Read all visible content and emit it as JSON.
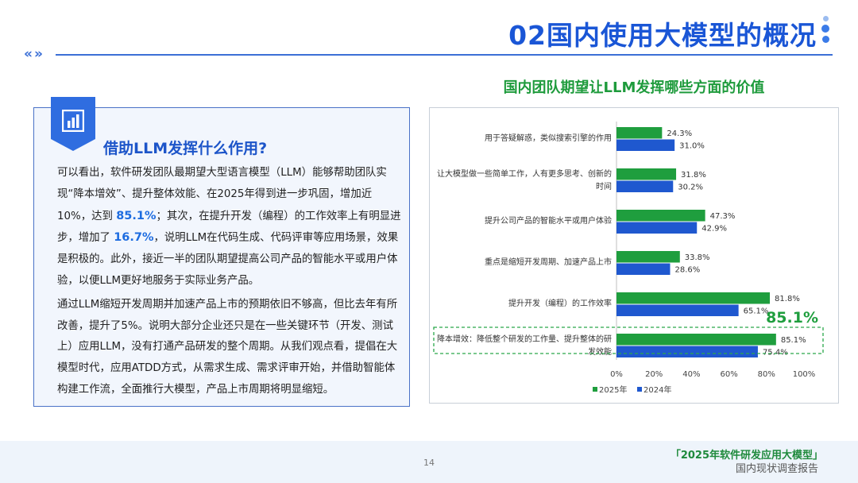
{
  "header": {
    "title": "02国内使用大模型的概况",
    "nav_symbol": "«»"
  },
  "left_panel": {
    "heading": "借助LLM发挥什么作用?",
    "para1_a": "可以看出，软件研发团队最期望大型语言模型（LLM）能够帮助团队实现“降本增效”、提升整体效能、在2025年得到进一步巩固，增加近10%，达到",
    "para1_h1": "85.1%",
    "para1_b": "；其次，在提升开发（编程）的工作效率上有明显进步，增加了",
    "para1_h2": "16.7%",
    "para1_c": "，说明LLM在代码生成、代码评审等应用场景，效果是积极的。此外，接近一半的团队期望提高公司产品的智能水平或用户体验，以便LLM更好地服务于实际业务产品。",
    "para2": "通过LLM缩短开发周期并加速产品上市的预期依旧不够高，但比去年有所改善，提升了5%。说明大部分企业还只是在一些关键环节（开发、测试上）应用LLM，没有打通产品研发的整个周期。从我们观点看，提倡在大模型时代，应用ATDD方式，从需求生成、需求评审开始，并借助智能体构建工作流，全面推行大模型，产品上市周期将明显缩短。"
  },
  "chart_data": {
    "type": "bar",
    "orientation": "horizontal",
    "title": "国内团队期望让LLM发挥哪些方面的价值",
    "categories": [
      [
        "用于答疑解惑，类似搜索引擎的作用"
      ],
      [
        "让大模型做一些简单工作，人有更多思考、创新的",
        "时间"
      ],
      [
        "提升公司产品的智能水平或用户体验"
      ],
      [
        "重点是缩短开发周期、加速产品上市"
      ],
      [
        "提升开发（编程）的工作效率"
      ],
      [
        "降本增效：降低整个研发的工作量、提升整体的研",
        "发效能"
      ]
    ],
    "series": [
      {
        "name": "2025年",
        "color": "#1f9e3e",
        "values": [
          24.3,
          31.8,
          47.3,
          33.8,
          81.8,
          85.1
        ]
      },
      {
        "name": "2024年",
        "color": "#1f58cf",
        "values": [
          31.0,
          30.2,
          42.9,
          28.6,
          65.1,
          75.4
        ]
      }
    ],
    "xlim": [
      0,
      100
    ],
    "ticks": [
      "0%",
      "20%",
      "40%",
      "60%",
      "80%",
      "100%"
    ],
    "legend": "bottom",
    "callout": {
      "text": "85.1%",
      "color": "#1f9e3e",
      "category_index": 5
    }
  },
  "footer": {
    "page_number": "14",
    "report_title": "「2025年软件研发应用大模型」",
    "report_subtitle": "国内现状调查报告"
  }
}
